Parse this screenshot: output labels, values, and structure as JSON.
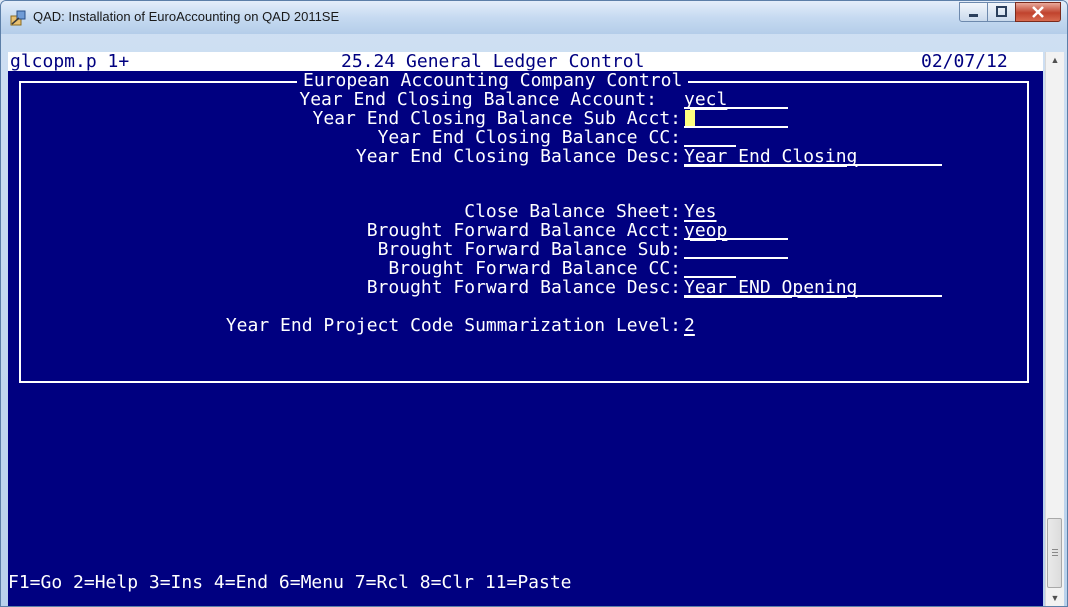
{
  "window": {
    "title": "QAD: Installation of EuroAccounting on QAD 2011SE",
    "icon": "qad-app-icon"
  },
  "header": {
    "program": "glcopm.p 1+",
    "menu_title": "25.24 General Ledger Control",
    "date": "02/07/12"
  },
  "frame": {
    "title": "European Accounting Company Control"
  },
  "fields": {
    "ye_close_acct": {
      "label": "Year End Closing Balance Account:",
      "value": "yecl"
    },
    "ye_close_sub": {
      "label": "Year End Closing Balance Sub Acct:",
      "value": ""
    },
    "ye_close_cc": {
      "label": "Year End Closing Balance CC:",
      "value": ""
    },
    "ye_close_desc": {
      "label": "Year End Closing Balance Desc:",
      "value": "Year End Closing"
    },
    "close_bs": {
      "label": "Close Balance Sheet:",
      "value": "Yes"
    },
    "bf_acct": {
      "label": "Brought Forward Balance Acct:",
      "value": "yeop"
    },
    "bf_sub": {
      "label": "Brought Forward Balance Sub:",
      "value": ""
    },
    "bf_cc": {
      "label": "Brought Forward Balance CC:",
      "value": ""
    },
    "bf_desc": {
      "label": "Brought Forward Balance Desc:",
      "value": "Year END Opening"
    },
    "summ_level": {
      "label": "Year End Project Code Summarization Level:",
      "value": "2"
    }
  },
  "footer": {
    "keys": "F1=Go 2=Help 3=Ins 4=End 6=Menu 7=Rcl 8=Clr 11=Paste"
  },
  "colors": {
    "terminal_bg": "#000080",
    "terminal_fg": "#ffffff",
    "cursor": "#ffff80"
  }
}
